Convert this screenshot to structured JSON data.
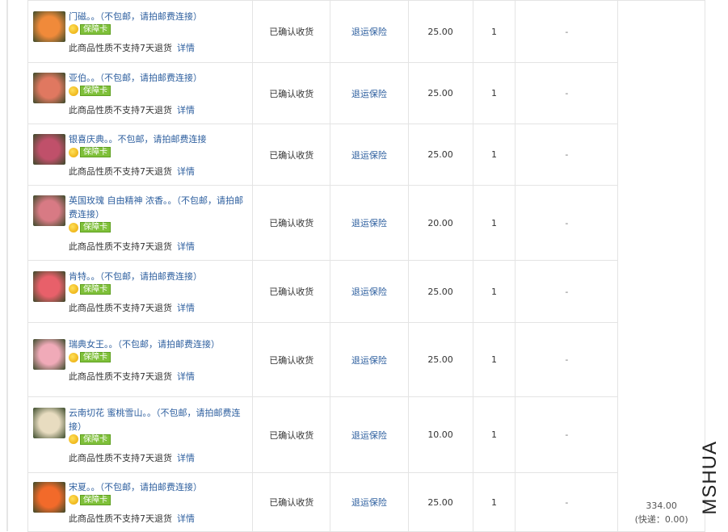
{
  "items": [
    {
      "title": "门磁。。（不包邮，请拍邮费连接）",
      "badge": "保障卡",
      "note": "此商品性质不支持7天退货",
      "detail": "详情",
      "status": "已确认收货",
      "insurance": "退运保险",
      "price": "25.00",
      "qty": "1",
      "dash": "-",
      "thumb_color": "#f08a3a"
    },
    {
      "title": "亚伯。。（不包邮，请拍邮费连接）",
      "badge": "保障卡",
      "note": "此商品性质不支持7天退货",
      "detail": "详情",
      "status": "已确认收货",
      "insurance": "退运保险",
      "price": "25.00",
      "qty": "1",
      "dash": "-",
      "thumb_color": "#e07860"
    },
    {
      "title": "银喜庆典。。不包邮，请拍邮费连接",
      "badge": "保障卡",
      "note": "此商品性质不支持7天退货",
      "detail": "详情",
      "status": "已确认收货",
      "insurance": "退运保险",
      "price": "25.00",
      "qty": "1",
      "dash": "-",
      "thumb_color": "#c0506a"
    },
    {
      "title": "英国玫瑰 自由精神 浓香。。（不包邮，请拍邮费连接）",
      "badge": "保障卡",
      "note": "此商品性质不支持7天退货",
      "detail": "详情",
      "status": "已确认收货",
      "insurance": "退运保险",
      "price": "20.00",
      "qty": "1",
      "dash": "-",
      "thumb_color": "#d87a84"
    },
    {
      "title": "肯特。。（不包邮，请拍邮费连接）",
      "badge": "保障卡",
      "note": "此商品性质不支持7天退货",
      "detail": "详情",
      "status": "已确认收货",
      "insurance": "退运保险",
      "price": "25.00",
      "qty": "1",
      "dash": "-",
      "thumb_color": "#e8606a"
    },
    {
      "title": "瑞典女王。。（不包邮，请拍邮费连接）",
      "badge": "保障卡",
      "note": "此商品性质不支持7天退货",
      "detail": "详情",
      "status": "已确认收货",
      "insurance": "退运保险",
      "price": "25.00",
      "qty": "1",
      "dash": "-",
      "thumb_color": "#f0aab8"
    },
    {
      "title": "云南切花 蜜桃雪山。。（不包邮，请拍邮费连接）",
      "badge": "保障卡",
      "note": "此商品性质不支持7天退货",
      "detail": "详情",
      "status": "已确认收货",
      "insurance": "退运保险",
      "price": "10.00",
      "qty": "1",
      "dash": "-",
      "thumb_color": "#e8dcc0"
    },
    {
      "title": "宋夏。。（不包邮，请拍邮费连接）",
      "badge": "保障卡",
      "note": "此商品性质不支持7天退货",
      "detail": "详情",
      "status": "已确认收货",
      "insurance": "退运保险",
      "price": "25.00",
      "qty": "1",
      "dash": "-",
      "thumb_color": "#f26a2a"
    }
  ],
  "total": {
    "amount": "334.00",
    "shipping": "(快递：0.00)"
  },
  "watermark": "MSHUA"
}
